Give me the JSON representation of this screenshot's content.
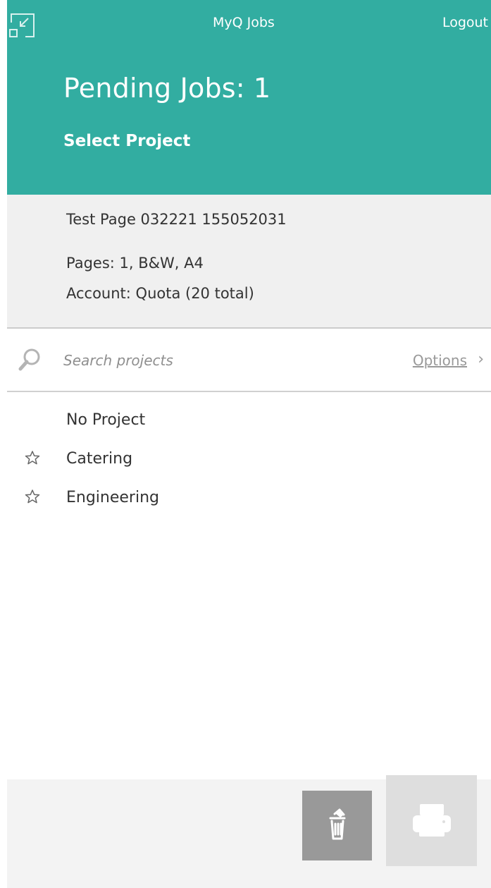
{
  "header": {
    "app_title": "MyQ Jobs",
    "logout_label": "Logout",
    "pending_label": "Pending Jobs:",
    "pending_count": "1",
    "select_project_label": "Select Project",
    "minimize_icon": "minimize-icon",
    "background_color": "#32ada1"
  },
  "job": {
    "name": "Test Page 032221 155052031",
    "pages": "Pages: 1, B&W, A4",
    "account": "Account: Quota (20 total)"
  },
  "search": {
    "placeholder": "Search projects",
    "value": "",
    "options_label": "Options",
    "options_chevron": "›",
    "search_icon": "search-icon"
  },
  "projects": [
    {
      "label": "No Project",
      "favorite_icon": ""
    },
    {
      "label": "Catering",
      "favorite_icon": "star-icon"
    },
    {
      "label": "Engineering",
      "favorite_icon": "star-icon"
    }
  ],
  "actions": {
    "delete_icon": "trash-icon",
    "print_icon": "printer-icon",
    "delete_button_color": "#999999",
    "print_button_color": "#dedede"
  }
}
